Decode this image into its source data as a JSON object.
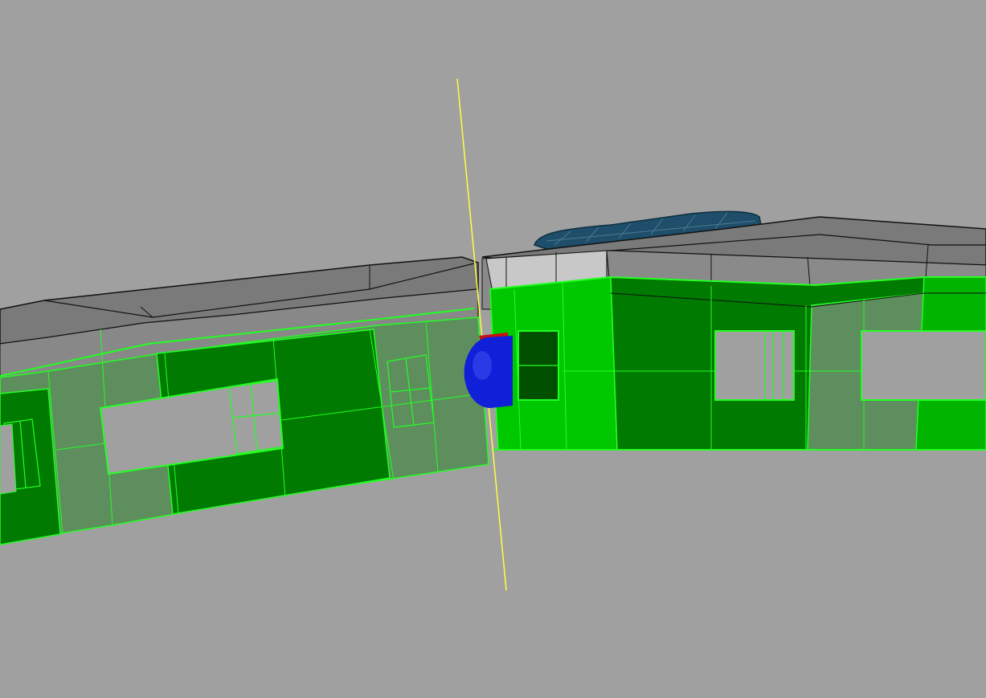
{
  "viewport": {
    "background": "#a0a0a0",
    "content": "3d-model-viewport",
    "labels": []
  },
  "colors": {
    "wall_dark": "#007a00",
    "wall_bright": "#00c800",
    "wall_tint": "#5c8c5c",
    "edge_green": "#22ff22",
    "roof": "#7a7a7a",
    "roof_line": "#111111",
    "fascia": "#8a8a8a",
    "fascia_light": "#c8c8c8",
    "skylight": "#1e4e6a",
    "axis_line": "#ffff40",
    "gizmo_blue": "#1020d8",
    "gizmo_red": "#cc1010",
    "door": "#005000",
    "window_void": "#a0a0a0"
  }
}
